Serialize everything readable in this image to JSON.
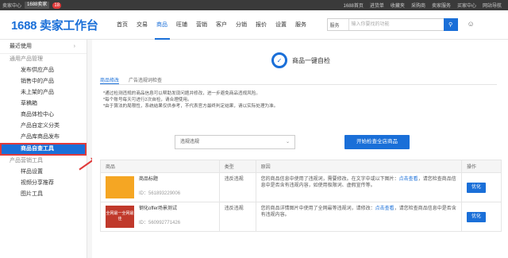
{
  "topbar": {
    "left_label": "卖家中心",
    "account": "1688卖家",
    "badge": "18",
    "right_items": [
      "1688首页",
      "进货单",
      "收藏夹",
      "采购商",
      "卖家服务",
      "买家中心",
      "网站导航"
    ]
  },
  "header": {
    "logo": "1688 卖家工作台",
    "nav": [
      "首页",
      "交易",
      "商品",
      "旺铺",
      "营销",
      "客户",
      "分销",
      "报价",
      "设置",
      "服务"
    ],
    "active_nav": "商品",
    "search_type": "服务",
    "search_placeholder": "输入你要找的功能"
  },
  "sidebar": {
    "top_item": "最近使用",
    "groups": [
      {
        "title": "通用产品管理",
        "items": [
          "发布供应产品",
          "销售中的产品",
          "未上架的产品",
          "草稿箱",
          "商品体检中心",
          "产品自定义分类",
          "产品库商品发布",
          "商品自查工具"
        ]
      },
      {
        "title": "产品营销工具",
        "items": [
          "样品设置",
          "视频分享推荐",
          "图片工具"
        ]
      }
    ],
    "active_item": "商品自查工具"
  },
  "main": {
    "tool_title": "商品一键自检",
    "tabs": [
      "商品修改",
      "广告违规词检查"
    ],
    "notes": [
      "*通过检测违规的商品信息可以帮助发现问题并修改，进一步避免商品违规风险。",
      "*每个账号每天可进行2次自检，请合理使用。",
      "*由于算法的局限性，系统结果仅供参考，不代表官方最终判定结果，请以实际处理为准。"
    ],
    "filter_value": "违规违规",
    "primary_button": "开始检查全店商品",
    "table": {
      "headers": [
        "商品",
        "类型",
        "原因",
        "操作"
      ],
      "rows": [
        {
          "thumb": "",
          "name": "商品标题",
          "id": "ID：561893229006",
          "type": "违反违规",
          "reason_pre": "您的商品信息中使用了违规词，需要修改。在文字中或以下图片：",
          "reason_link": "点击查看",
          "reason_post": "，请您检查商品信息中是否含有违规内容，如使用极限词、虚假宣传等。",
          "action": "优化"
        },
        {
          "thumb": "全网最一全网最佳",
          "name": "钢化offer场景测试",
          "id": "ID：560992771426",
          "type": "违反违规",
          "reason_pre": "您的商品详情图片中使用了全网最等违规词，请修改：",
          "reason_link": "点击查看",
          "reason_post": "，请您检查商品信息中是否含有违规内容。",
          "action": "优化"
        }
      ]
    }
  }
}
